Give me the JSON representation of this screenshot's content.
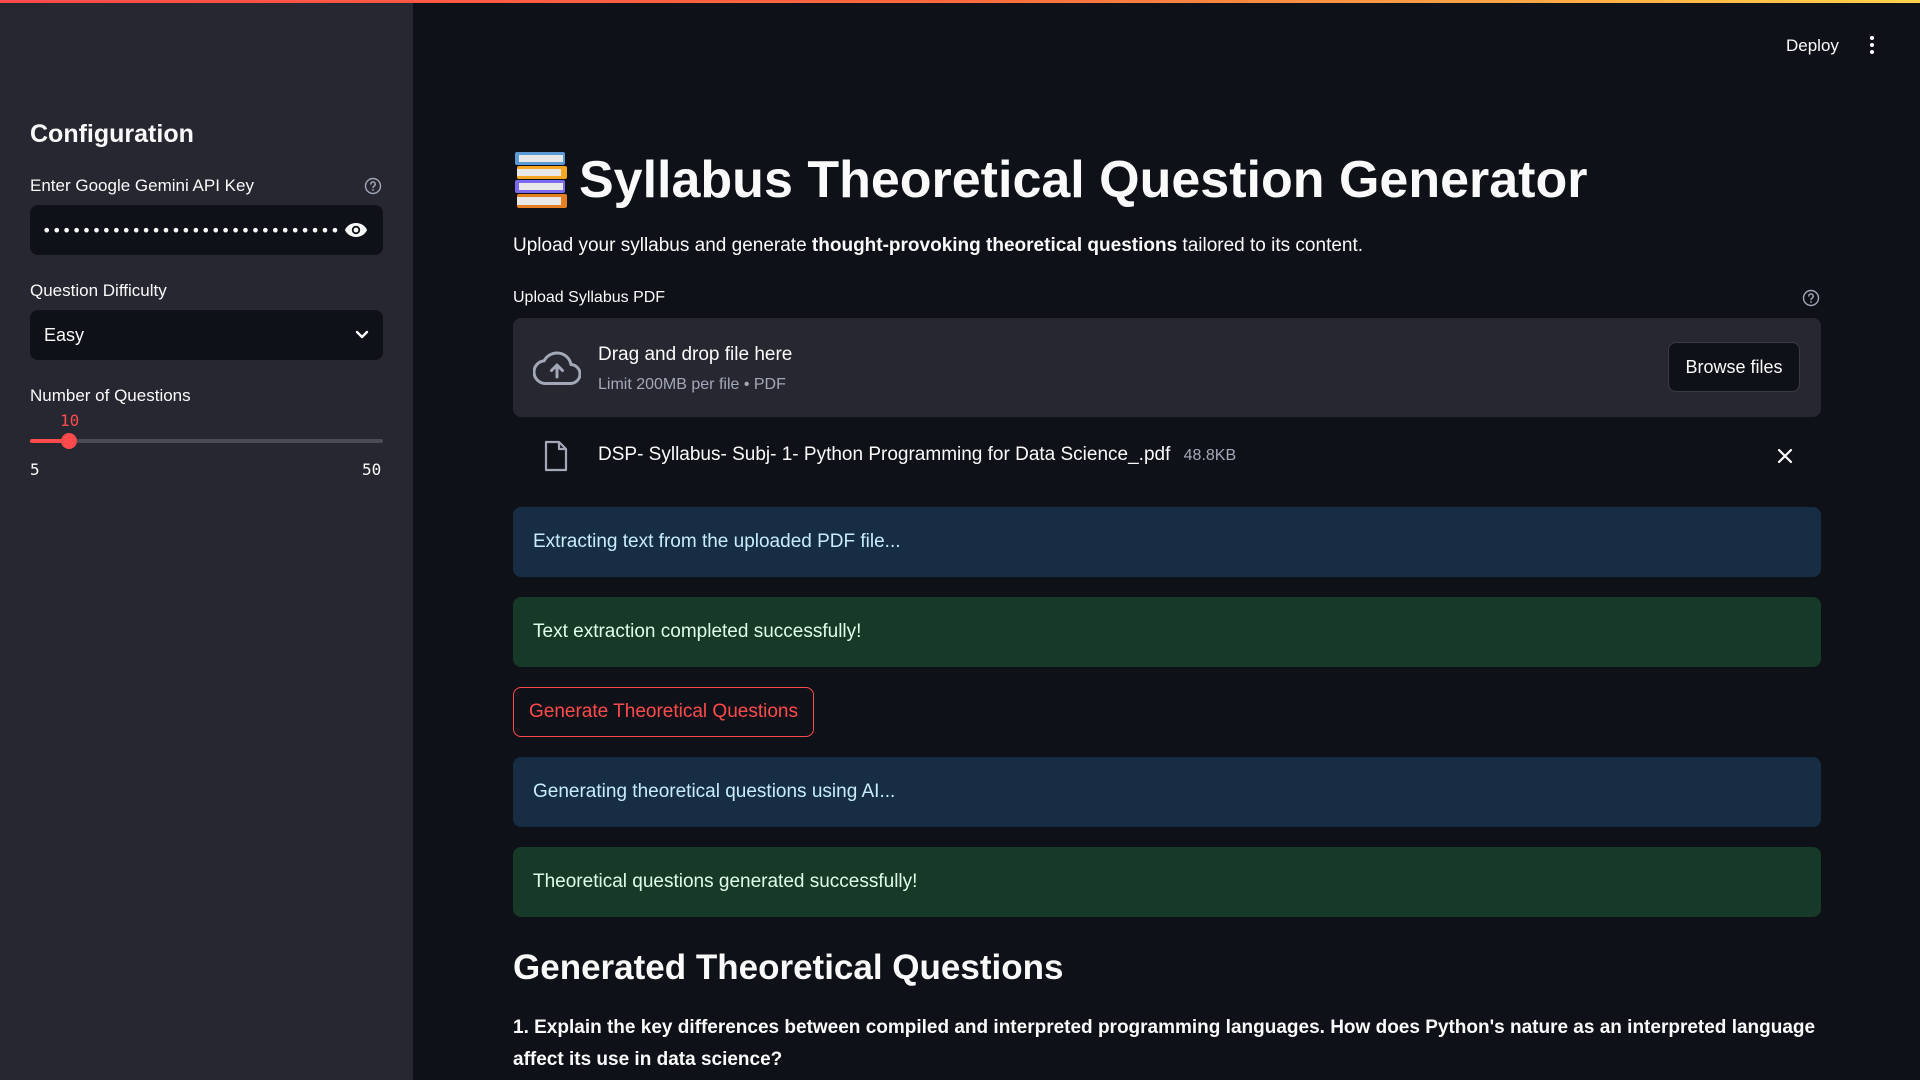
{
  "header": {
    "deploy_label": "Deploy",
    "menu_icon": "more-vert-icon"
  },
  "sidebar": {
    "title": "Configuration",
    "api_key": {
      "label": "Enter Google Gemini API Key",
      "value": "••••••••••••••••••••••••••••••••••••••",
      "visibility_icon": "eye-icon"
    },
    "difficulty": {
      "label": "Question Difficulty",
      "selected": "Easy"
    },
    "num_questions": {
      "label": "Number of Questions",
      "value": 10,
      "value_text": "10",
      "min": 5,
      "min_text": "5",
      "max": 50,
      "max_text": "50"
    }
  },
  "main": {
    "title": "Syllabus Theoretical Question Generator",
    "title_icon": "books-icon",
    "subtitle_pre": "Upload your syllabus and generate ",
    "subtitle_bold": "thought-provoking theoretical questions",
    "subtitle_post": " tailored to its content.",
    "upload": {
      "label": "Upload Syllabus PDF",
      "drop_title": "Drag and drop file here",
      "drop_limit": "Limit 200MB per file • PDF",
      "browse_label": "Browse files",
      "file_name": "DSP- Syllabus- Subj- 1- Python Programming for Data Science_.pdf",
      "file_size": "48.8KB"
    },
    "alerts": {
      "extracting": "Extracting text from the uploaded PDF file...",
      "extracted": "Text extraction completed successfully!",
      "generating": "Generating theoretical questions using AI...",
      "generated": "Theoretical questions generated successfully!"
    },
    "generate_button": "Generate Theoretical Questions",
    "results_title": "Generated Theoretical Questions",
    "questions": [
      "1. Explain the key differences between compiled and interpreted programming languages. How does Python's nature as an interpreted language affect its use in data science?"
    ]
  },
  "colors": {
    "accent": "#ff4b4b",
    "sidebar_bg": "#262730",
    "main_bg": "#0e1117",
    "info_bg": "#172d43",
    "success_bg": "#173928"
  }
}
